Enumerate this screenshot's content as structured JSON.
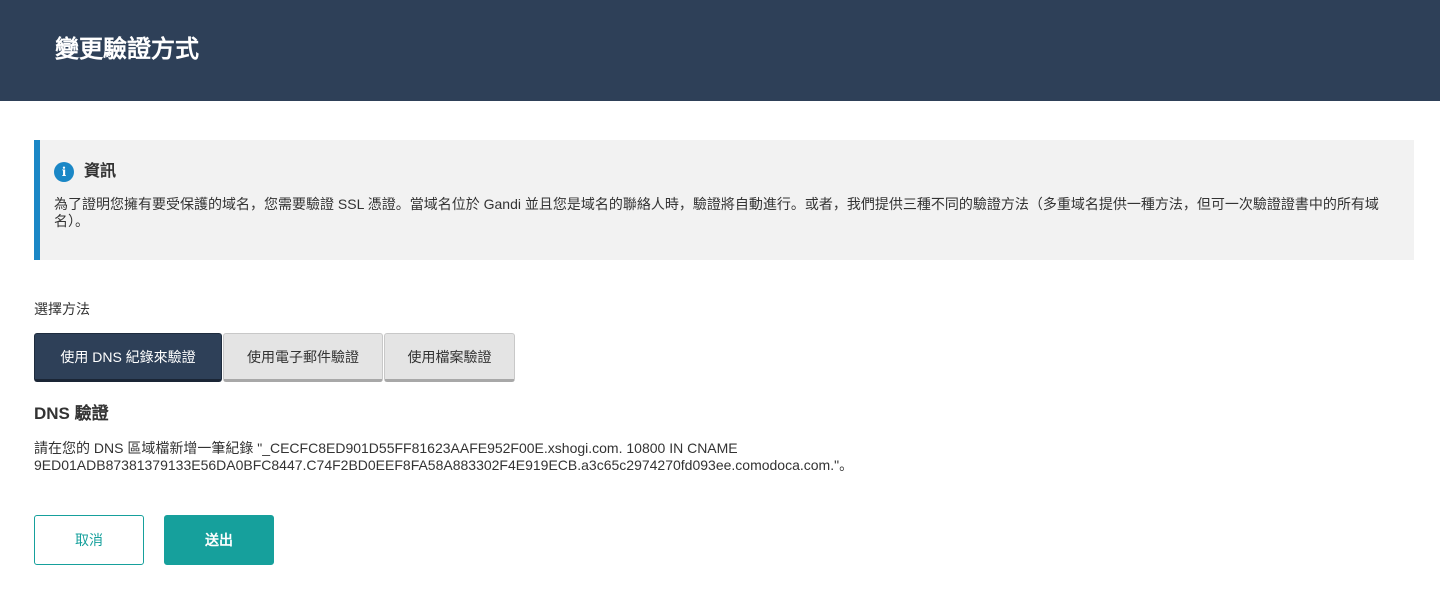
{
  "header": {
    "title": "變更驗證方式"
  },
  "info": {
    "icon": "info-icon",
    "icon_glyph": "i",
    "title": "資訊",
    "text": "為了證明您擁有要受保護的域名，您需要驗證 SSL 憑證。當域名位於 Gandi 並且您是域名的聯絡人時，驗證將自動進行。或者，我們提供三種不同的驗證方法（多重域名提供一種方法，但可一次驗證證書中的所有域名）。",
    "accent": "#1a87c6"
  },
  "method": {
    "label": "選擇方法",
    "tabs": [
      {
        "label": "使用 DNS 紀錄來驗證",
        "active": true
      },
      {
        "label": "使用電子郵件驗證",
        "active": false
      },
      {
        "label": "使用檔案驗證",
        "active": false
      }
    ]
  },
  "dns": {
    "title": "DNS 驗證",
    "text_line1": "請在您的 DNS 區域檔新增一筆紀錄 \"_CECFC8ED901D55FF81623AAFE952F00E.xshogi.com. 10800 IN CNAME",
    "text_line2": "9ED01ADB87381379133E56DA0BFC8447.C74F2BD0EEF8FA58A883302F4E919ECB.a3c65c2974270fd093ee.comodoca.com.\"。"
  },
  "actions": {
    "cancel": "取消",
    "submit": "送出"
  },
  "colors": {
    "header_bg": "#2e4058",
    "primary": "#16a09c",
    "active_tab": "#2e4058"
  }
}
